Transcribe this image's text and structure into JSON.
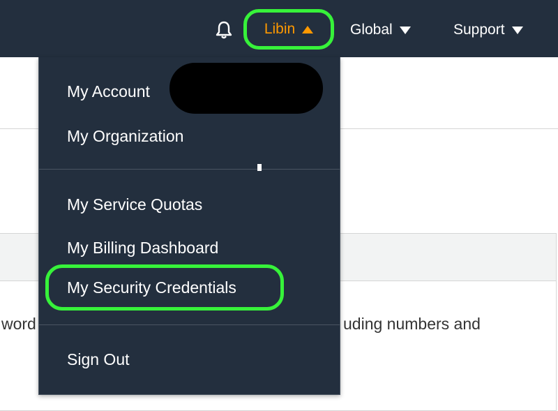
{
  "nav": {
    "bell_icon": "bell-icon",
    "user": "Libin",
    "region": "Global",
    "support": "Support",
    "accent": "#ff9900",
    "highlight": "#37f23a",
    "bar_color": "#232f3e"
  },
  "menu": {
    "account": "My Account",
    "organization": "My Organization",
    "service_quotas": "My Service Quotas",
    "billing": "My Billing Dashboard",
    "security": "My Security Credentials",
    "sign_out": "Sign Out"
  },
  "background": {
    "text_left": "word",
    "text_right": "uding numbers and"
  }
}
